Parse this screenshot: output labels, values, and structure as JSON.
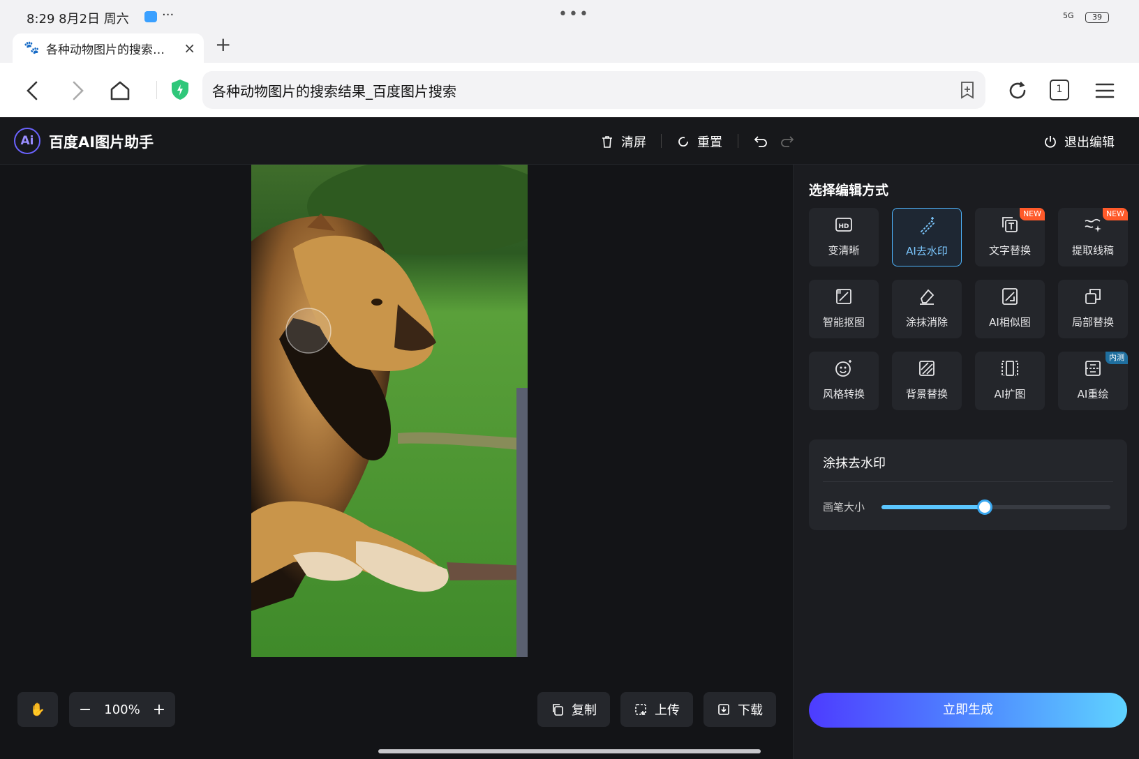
{
  "statusbar": {
    "time": "8:29  8月2日 周六",
    "more": "···",
    "center": "•••",
    "signal": "5G",
    "battery": "39"
  },
  "browser": {
    "tab_title": "各种动物图片的搜索结果_百度图片搜索",
    "tab_title_display": "各种动物图片的搜索…",
    "new_tab": "+",
    "close": "×",
    "url": "各种动物图片的搜索结果_百度图片搜索",
    "tab_count": "1"
  },
  "app": {
    "logo": "Ai",
    "title": "百度AI图片助手",
    "toolbar": {
      "clear": "清屏",
      "reset": "重置",
      "exit": "退出编辑"
    },
    "bottom": {
      "hand": "✋",
      "zoom": "100%",
      "copy": "复制",
      "upload": "上传",
      "download": "下载"
    },
    "panel": {
      "title": "选择编辑方式",
      "tools": [
        {
          "label": "变清晰",
          "icon": "hd-icon"
        },
        {
          "label": "AI去水印",
          "icon": "magic-wand-icon",
          "active": true
        },
        {
          "label": "文字替换",
          "icon": "text-replace-icon",
          "badge": "NEW"
        },
        {
          "label": "提取线稿",
          "icon": "line-art-icon",
          "badge": "NEW"
        },
        {
          "label": "智能抠图",
          "icon": "cutout-icon"
        },
        {
          "label": "涂抹消除",
          "icon": "eraser-icon"
        },
        {
          "label": "AI相似图",
          "icon": "similar-image-icon"
        },
        {
          "label": "局部替换",
          "icon": "partial-replace-icon"
        },
        {
          "label": "风格转换",
          "icon": "style-icon"
        },
        {
          "label": "背景替换",
          "icon": "background-icon"
        },
        {
          "label": "AI扩图",
          "icon": "expand-icon"
        },
        {
          "label": "AI重绘",
          "icon": "redraw-icon",
          "badge": "内测"
        }
      ],
      "sub": {
        "title": "涂抹去水印",
        "brush_label": "画笔大小",
        "brush_value": 0.45
      },
      "generate": "立即生成"
    }
  },
  "colors": {
    "accent": "#4fb6ff",
    "badge_new": "#ff5a2a",
    "badge_beta": "#1f6f9f"
  }
}
